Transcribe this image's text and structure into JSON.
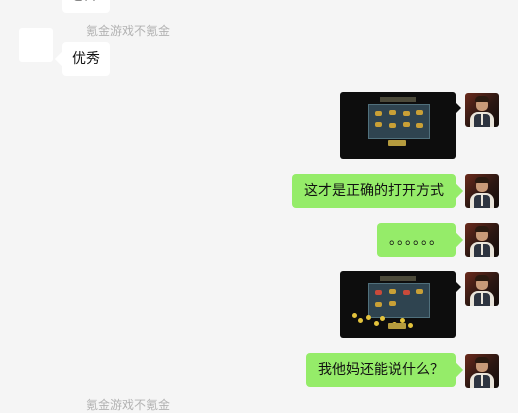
{
  "messages": [
    {
      "side": "left",
      "sender": "",
      "text": "乚ㄇ"
    },
    {
      "side": "left",
      "sender": "氪金游戏不氪金",
      "text": "优秀"
    },
    {
      "side": "right",
      "type": "image",
      "icon": "game-reward-screenshot"
    },
    {
      "side": "right",
      "text": "这才是正确的打开方式"
    },
    {
      "side": "right",
      "text": "。。。。。。"
    },
    {
      "side": "right",
      "type": "image",
      "icon": "game-reward-screenshot"
    },
    {
      "side": "right",
      "text": "我他妈还能说什么？"
    },
    {
      "side": "left",
      "sender": "氪金游戏不氪金"
    }
  ],
  "colors": {
    "background": "#f5f5f5",
    "incoming_bubble": "#ffffff",
    "outgoing_bubble": "#95ec69",
    "sender_name": "#b2b2b2"
  }
}
